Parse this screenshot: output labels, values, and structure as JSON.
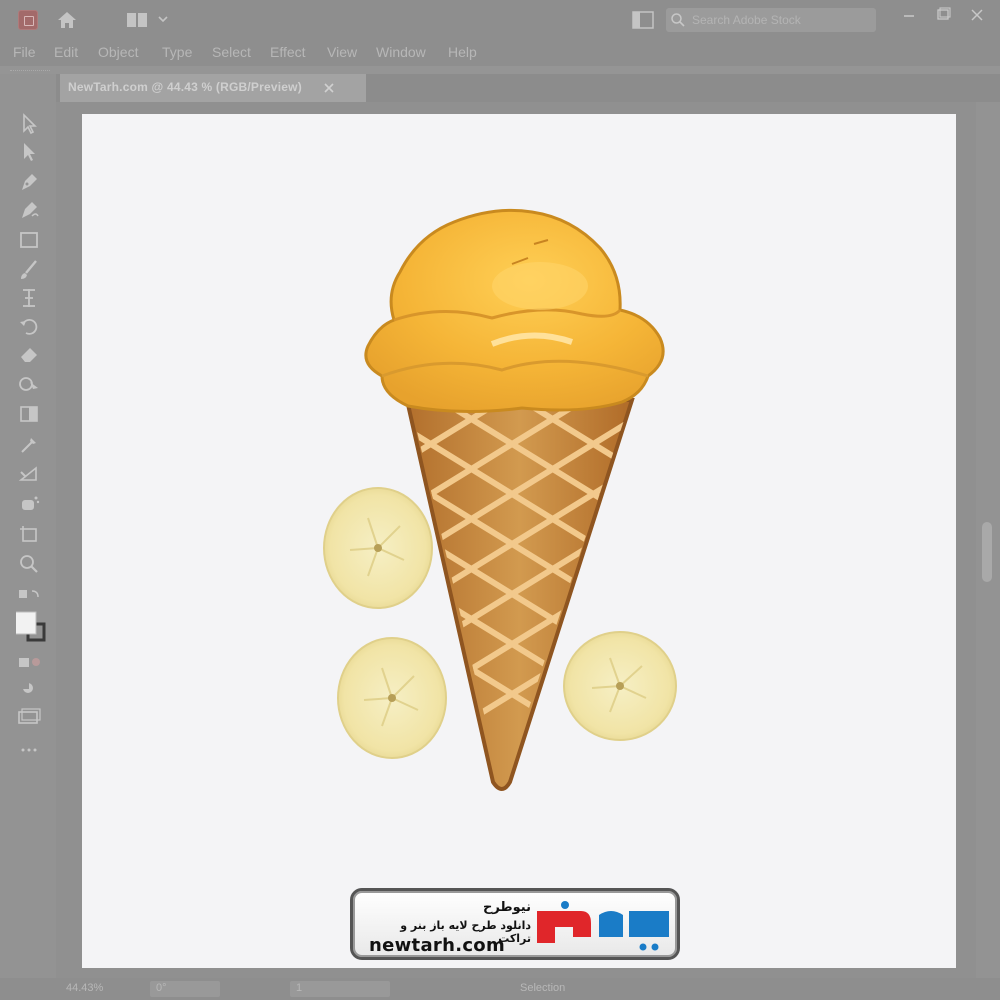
{
  "menu": {
    "file": "File",
    "edit": "Edit",
    "object": "Object",
    "type": "Type",
    "select": "Select",
    "effect": "Effect",
    "view": "View",
    "window": "Window",
    "help": "Help"
  },
  "search": {
    "placeholder": "Search Adobe Stock"
  },
  "document_tab": {
    "title": "NewTarh.com @ 44.43 % (RGB/Preview)"
  },
  "status": {
    "zoom": "44.43%",
    "rotation": "0°",
    "artboard": "1",
    "mode": "Selection"
  },
  "badge": {
    "title": "نیوطرح",
    "subtitle": "دانلود طرح لایه باز بنر و تراکت",
    "url": "newtarh.com",
    "logo_text": "نیوطرح"
  },
  "colors": {
    "ui_gray": "#939393",
    "artboard": "#f4f4f6",
    "ice_cream": "#f5b93a",
    "cone": "#c98a3c",
    "banana": "#f3e9b0",
    "logo_red": "#e0262a"
  },
  "icons": {
    "app": "illustrator-logo-icon",
    "home": "home-icon",
    "workspace": "workspace-icon",
    "search": "search-icon"
  }
}
